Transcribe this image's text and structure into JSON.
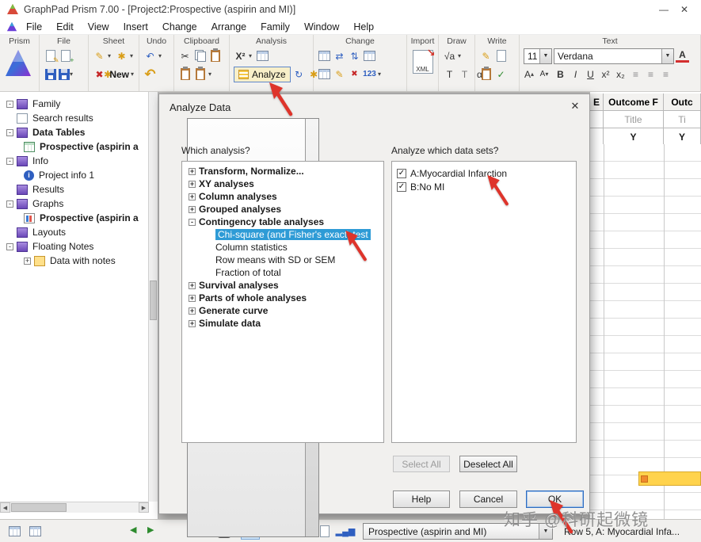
{
  "colors": {
    "selection": "#2e9bd6",
    "arrow_red": "#de342b",
    "highlight_yellow": "#ffd34d",
    "analyze_highlight": "#f8efc9"
  },
  "icons": {
    "minimize": "—",
    "close": "✕",
    "dropdown": "▼",
    "caret": "▾",
    "expand": "+",
    "collapse": "-",
    "back": "◀",
    "forward": "▶",
    "undo": "↶",
    "scissors": "✂",
    "pencil": "✎",
    "wand": "✱",
    "star": "✱",
    "delete": "✖",
    "check": "✓",
    "alpha": "α",
    "sqrt": "√a",
    "chi": "X²",
    "superscript": "x²",
    "subscript": "x₂",
    "bold": "B",
    "italic": "I",
    "underline": "U",
    "letter_a": "A",
    "letter_t": "T",
    "align": "≡",
    "import_arrow": "↘",
    "chart_bars": "▂▄▆",
    "repeat": "↻",
    "swap_h": "⇄",
    "swap_v": "⇅",
    "info": "i",
    "up_small": "▴",
    "down_small": "▾"
  },
  "window": {
    "title": "GraphPad Prism 7.00 - [Project2:Prospective (aspirin and MI)]"
  },
  "menu": {
    "items": [
      "File",
      "Edit",
      "View",
      "Insert",
      "Change",
      "Arrange",
      "Family",
      "Window",
      "Help"
    ]
  },
  "toolbar": {
    "sections": {
      "prism": "Prism",
      "file": "File",
      "sheet": "Sheet",
      "undo": "Undo",
      "clipboard": "Clipboard",
      "analysis": "Analysis",
      "change": "Change",
      "import": "Import",
      "draw": "Draw",
      "write": "Write",
      "text": "Text"
    },
    "new_label": "New",
    "analyze_label": "Analyze",
    "numbers_label": "123",
    "xml_label": "XML",
    "font_size": "11",
    "font_name": "Verdana"
  },
  "sidebar": {
    "items": [
      "Family",
      "Search results",
      "Data Tables",
      "Prospective (aspirin a",
      "Info",
      "Project info 1",
      "Results",
      "Graphs",
      "Prospective (aspirin a",
      "Layouts",
      "Floating Notes",
      "Data with notes"
    ]
  },
  "dialog": {
    "title": "Analyze Data",
    "type_value": "Built-in analysis",
    "which_label": "Which analysis?",
    "datasets_label": "Analyze which data sets?",
    "tree": [
      "Transform, Normalize...",
      "XY analyses",
      "Column analyses",
      "Grouped analyses",
      "Contingency table analyses",
      "Chi-square (and Fisher's exact) test",
      "Column statistics",
      "Row means with SD or SEM",
      "Fraction of total",
      "Survival analyses",
      "Parts of whole analyses",
      "Generate curve",
      "Simulate data"
    ],
    "datasets": [
      "A:Myocardial Infarction",
      "B:No MI"
    ],
    "select_all": "Select All",
    "deselect_all": "Deselect All",
    "help": "Help",
    "cancel": "Cancel",
    "ok": "OK"
  },
  "table": {
    "col_e": "E",
    "col_outcome": "Outcome F",
    "col_outcome_next": "Outc",
    "title_row": "Title",
    "title_row_next": "Ti",
    "y_label": "Y",
    "y_label_next": "Y"
  },
  "statusbar": {
    "sheet_selector": "Prospective (aspirin and MI)",
    "row_info": "Row 5, A: Myocardial Infa...",
    "watermark": "知乎 @科研起微镜"
  }
}
